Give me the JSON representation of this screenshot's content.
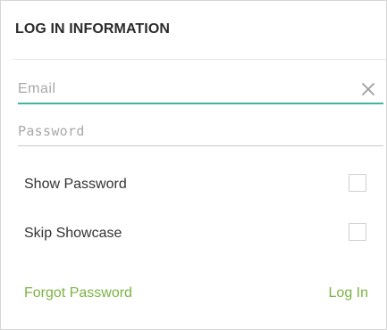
{
  "header": {
    "title": "LOG IN INFORMATION"
  },
  "form": {
    "email": {
      "placeholder": "Email",
      "value": "",
      "clear_icon": "close-icon"
    },
    "password": {
      "placeholder": "Password",
      "value": ""
    }
  },
  "options": {
    "show_password": {
      "label": "Show Password",
      "checked": false
    },
    "skip_showcase": {
      "label": "Skip Showcase",
      "checked": false
    }
  },
  "actions": {
    "forgot_password": "Forgot Password",
    "log_in": "Log In"
  },
  "colors": {
    "accent": "#7cb342",
    "focus_underline": "#3fb6a2",
    "title": "#2b2b2b",
    "placeholder": "#a8a8a8"
  }
}
